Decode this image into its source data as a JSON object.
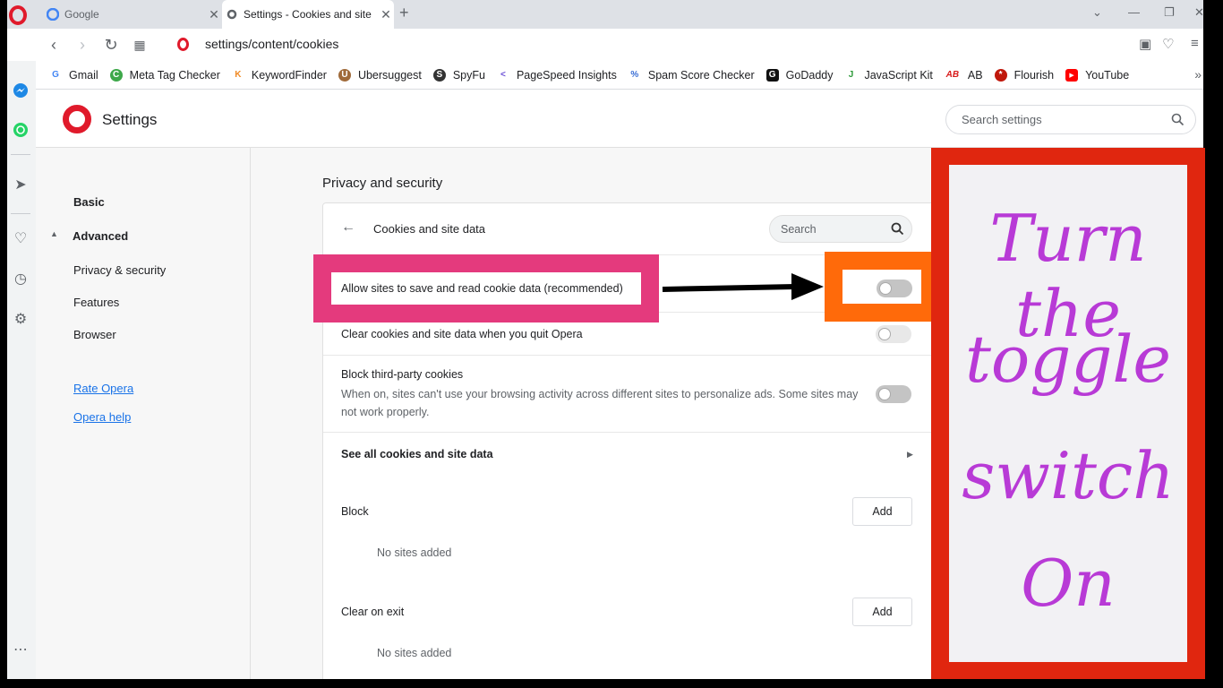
{
  "browser": {
    "tabs": [
      {
        "title": "Google",
        "active": false
      },
      {
        "title": "Settings - Cookies and site",
        "active": true
      }
    ],
    "new_tab_symbol": "+",
    "address": "settings/content/cookies",
    "address_host": "settings",
    "address_path": "/content/cookies"
  },
  "bookmarks": [
    {
      "label": "Gmail",
      "icon": "google-icon",
      "color": "#4285f4",
      "glyph": "G"
    },
    {
      "label": "Meta Tag Checker",
      "icon": "metatag-icon",
      "color": "#3ea84a",
      "glyph": "C"
    },
    {
      "label": "KeywordFinder",
      "icon": "keywordfinder-icon",
      "color": "#f08a24",
      "glyph": "K"
    },
    {
      "label": "Ubersuggest",
      "icon": "ubersuggest-icon",
      "color": "#a06a3a",
      "glyph": "U"
    },
    {
      "label": "SpyFu",
      "icon": "spyfu-icon",
      "color": "#333333",
      "glyph": "S"
    },
    {
      "label": "PageSpeed Insights",
      "icon": "pagespeed-icon",
      "color": "#6a4fd6",
      "glyph": "<"
    },
    {
      "label": "Spam Score Checker",
      "icon": "link-icon",
      "color": "#3b6fd6",
      "glyph": "%"
    },
    {
      "label": "GoDaddy",
      "icon": "godaddy-icon",
      "color": "#111111",
      "glyph": "G"
    },
    {
      "label": "JavaScript Kit",
      "icon": "javascriptkit-icon",
      "color": "#2e9a3a",
      "glyph": "J"
    },
    {
      "label": "AB",
      "icon": "ab-icon",
      "color": "#d81b1b",
      "glyph": "AB"
    },
    {
      "label": "Flourish",
      "icon": "flourish-icon",
      "color": "#c0180c",
      "glyph": "*"
    },
    {
      "label": "YouTube",
      "icon": "youtube-icon",
      "color": "#ff0000",
      "glyph": "▶"
    }
  ],
  "settings": {
    "title": "Settings",
    "search_placeholder": "Search settings",
    "nav": {
      "basic": "Basic",
      "advanced": "Advanced",
      "privacy": "Privacy & security",
      "features": "Features",
      "browser": "Browser",
      "rate": "Rate Opera",
      "help": "Opera help"
    },
    "section_title": "Privacy and security",
    "card": {
      "title": "Cookies and site data",
      "search_placeholder": "Search",
      "allow_cookies": "Allow sites to save and read cookie data (recommended)",
      "allow_cookies_on": false,
      "clear_on_quit": "Clear cookies and site data when you quit Opera",
      "clear_on_quit_on": false,
      "block_third_party": "Block third-party cookies",
      "block_third_party_desc": "When on, sites can't use your browsing activity across different sites to personalize ads. Some sites may not work properly.",
      "block_third_party_on": false,
      "see_all": "See all cookies and site data",
      "block_label": "Block",
      "clear_exit_label": "Clear on exit",
      "add_label": "Add",
      "no_sites": "No sites added"
    }
  },
  "annotation": {
    "lines": [
      "Turn the",
      "toggle",
      "switch",
      "On"
    ],
    "colors": {
      "pink": "#e43a7d",
      "orange": "#ff6a0a",
      "red": "#e0260f",
      "text": "#b83ad6"
    }
  }
}
